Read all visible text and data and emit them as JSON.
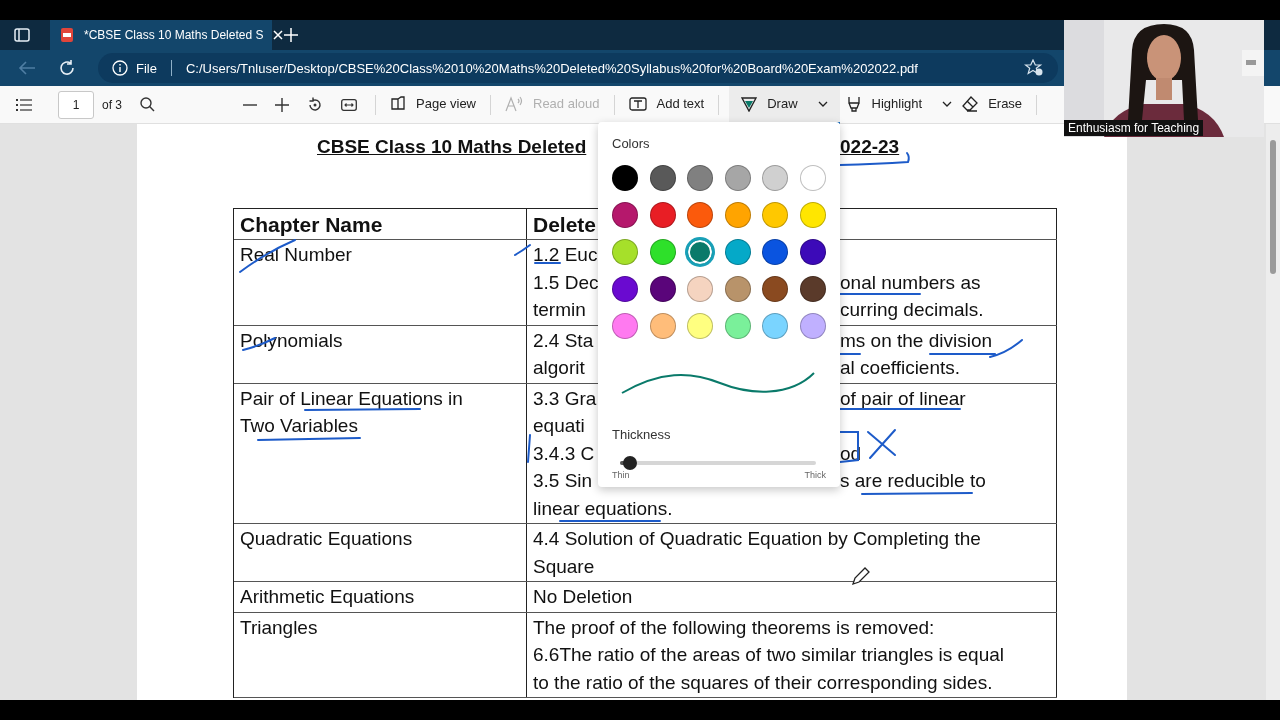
{
  "tab_bar": {
    "tab": {
      "title": "*CBSE Class 10 Maths Deleted S",
      "selected": true
    }
  },
  "address_bar": {
    "back_disabled": true,
    "scheme": "File",
    "url": "C:/Users/Tnluser/Desktop/CBSE%20Class%2010%20Maths%20Deleted%20Syllabus%20for%20Board%20Exam%202022.pdf"
  },
  "toolbar": {
    "page_number": "1",
    "page_count": "of 3",
    "tools": [
      {
        "kind": "page-view",
        "label": "Page view",
        "selected": false,
        "disabled": false,
        "dropdown": false
      },
      {
        "kind": "read-aloud",
        "label": "Read aloud",
        "selected": false,
        "disabled": true,
        "dropdown": false
      },
      {
        "kind": "add-text",
        "label": "Add text",
        "selected": false,
        "disabled": false,
        "dropdown": false
      },
      {
        "kind": "draw",
        "label": "Draw",
        "selected": true,
        "disabled": false,
        "dropdown": true
      },
      {
        "kind": "highlight",
        "label": "Highlight",
        "selected": false,
        "disabled": false,
        "dropdown": true
      },
      {
        "kind": "erase",
        "label": "Erase",
        "selected": false,
        "disabled": false,
        "dropdown": false
      }
    ]
  },
  "document": {
    "title_parts": [
      "CBSE Class 10 Maths Deleted",
      "022-23"
    ],
    "table": {
      "headers": [
        {
          "segments": [
            "Chapter Name"
          ]
        },
        {
          "segments": [
            "Delete"
          ]
        }
      ],
      "rows": [
        {
          "chapter": [
            "Real Number"
          ],
          "deleted": [
            {
              "segments": [
                "1.2 Euc"
              ]
            },
            {
              "segments": [
                "1.5 Dec",
                "onal numbers as"
              ]
            },
            {
              "segments": [
                "termin",
                "curring decimals."
              ]
            }
          ]
        },
        {
          "chapter": [
            "Polynomials"
          ],
          "deleted": [
            {
              "segments": [
                "2.4 Sta",
                "ms on the division"
              ]
            },
            {
              "segments": [
                "algorit",
                "al coefficients."
              ]
            }
          ]
        },
        {
          "chapter": [
            "Pair of Linear Equations in",
            "Two Variables"
          ],
          "deleted": [
            {
              "segments": [
                "3.3 Gra",
                "of pair of linear"
              ]
            },
            {
              "segments": [
                "equati"
              ]
            },
            {
              "segments": [
                "3.4.3 C",
                "od"
              ]
            },
            {
              "segments": [
                "3.5 Sin",
                "s are reducible to"
              ]
            },
            {
              "segments": [
                "linear equations."
              ]
            }
          ]
        },
        {
          "chapter": [
            "Quadratic Equations"
          ],
          "deleted": [
            {
              "segments": [
                "4.4 Solution of Quadratic Equation by Completing the"
              ]
            },
            {
              "segments": [
                "Square"
              ]
            }
          ]
        },
        {
          "chapter": [
            "Arithmetic Equations"
          ],
          "deleted": [
            {
              "segments": [
                "No Deletion"
              ]
            }
          ]
        },
        {
          "chapter": [
            "Triangles"
          ],
          "deleted": [
            {
              "segments": [
                "The proof of the following theorems is removed:"
              ]
            },
            {
              "segments": [
                "6.6The ratio of the areas of two similar triangles is equal"
              ]
            },
            {
              "segments": [
                "to the ratio of the squares of their corresponding sides."
              ]
            }
          ]
        }
      ]
    }
  },
  "draw_menu": {
    "title": "Colors",
    "swatches": [
      {
        "color": "#000000",
        "selected": false
      },
      {
        "color": "#595959",
        "selected": false
      },
      {
        "color": "#808080",
        "selected": false
      },
      {
        "color": "#a6a6a6",
        "selected": false
      },
      {
        "color": "#d0d0d0",
        "selected": false
      },
      {
        "color": "#ffffff",
        "selected": false
      },
      {
        "color": "#b5186c",
        "selected": false
      },
      {
        "color": "#e81e25",
        "selected": false
      },
      {
        "color": "#fb5a0c",
        "selected": false
      },
      {
        "color": "#ffa400",
        "selected": false
      },
      {
        "color": "#ffc800",
        "selected": false
      },
      {
        "color": "#ffe600",
        "selected": false
      },
      {
        "color": "#a6e02a",
        "selected": false
      },
      {
        "color": "#2ee02a",
        "selected": false
      },
      {
        "color": "#0a7a6a",
        "selected": true
      },
      {
        "color": "#05a9c8",
        "selected": false
      },
      {
        "color": "#0a54e0",
        "selected": false
      },
      {
        "color": "#3c0ab8",
        "selected": false
      },
      {
        "color": "#6a0ad0",
        "selected": false
      },
      {
        "color": "#5a057a",
        "selected": false
      },
      {
        "color": "#f5d4c0",
        "selected": false
      },
      {
        "color": "#b8936a",
        "selected": false
      },
      {
        "color": "#8a4a20",
        "selected": false
      },
      {
        "color": "#5a3a2a",
        "selected": false
      },
      {
        "color": "#ff7af0",
        "selected": false
      },
      {
        "color": "#ffbd7a",
        "selected": false
      },
      {
        "color": "#ffff80",
        "selected": false
      },
      {
        "color": "#7af09a",
        "selected": false
      },
      {
        "color": "#7ad4ff",
        "selected": false
      },
      {
        "color": "#c0b0ff",
        "selected": false
      }
    ],
    "thickness_label": "Thickness",
    "thickness": {
      "level": 0.05
    },
    "min_label": "Thin",
    "max_label": "Thick"
  },
  "webcam": {
    "caption": "Enthusiasm for Teaching"
  }
}
